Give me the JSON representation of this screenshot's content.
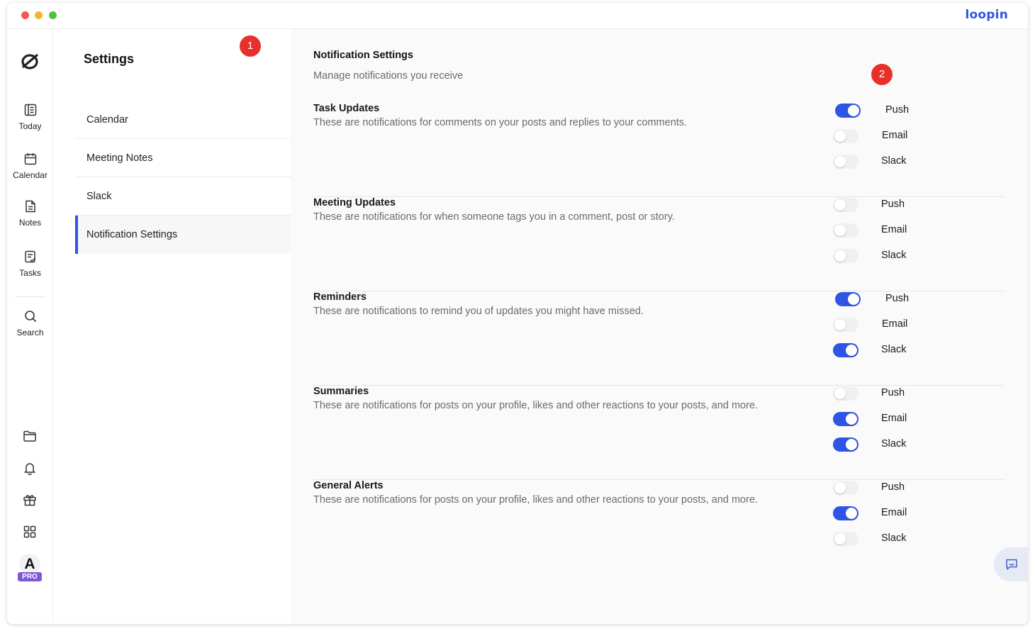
{
  "app": {
    "brand": "loopin"
  },
  "rail": {
    "items": [
      {
        "label": "Today",
        "icon": "today-icon"
      },
      {
        "label": "Calendar",
        "icon": "calendar-icon"
      },
      {
        "label": "Notes",
        "icon": "notes-icon"
      },
      {
        "label": "Tasks",
        "icon": "tasks-icon"
      },
      {
        "label": "Search",
        "icon": "search-icon"
      }
    ],
    "bottom_icons": [
      "folder-icon",
      "bell-icon",
      "gift-icon",
      "apps-grid-icon"
    ],
    "avatar": {
      "initial": "A",
      "badge": "PRO"
    }
  },
  "settings": {
    "title": "Settings",
    "step_badge": "1",
    "menu": [
      "Calendar",
      "Meeting Notes",
      "Slack",
      "Notification Settings"
    ],
    "active_item": "Notification Settings"
  },
  "notifications": {
    "title": "Notification Settings",
    "subtitle": "Manage notifications you receive",
    "step_badge": "2",
    "sections": [
      {
        "title": "Task Updates",
        "description": "These are notifications for comments on your posts and replies to your comments.",
        "toggles": [
          {
            "label": "Push",
            "on": true
          },
          {
            "label": "Email",
            "on": false
          },
          {
            "label": "Slack",
            "on": false
          }
        ]
      },
      {
        "title": "Meeting Updates",
        "description": "These are notifications for when someone tags you in a comment, post or story.",
        "toggles": [
          {
            "label": "Push",
            "on": false
          },
          {
            "label": "Email",
            "on": false
          },
          {
            "label": "Slack",
            "on": false
          }
        ]
      },
      {
        "title": "Reminders",
        "description": "These are notifications to remind you of updates you might have missed.",
        "toggles": [
          {
            "label": "Push",
            "on": true
          },
          {
            "label": "Email",
            "on": false
          },
          {
            "label": "Slack",
            "on": true
          }
        ]
      },
      {
        "title": "Summaries",
        "description": "These are notifications for posts on your profile, likes and other reactions to your posts, and more.",
        "toggles": [
          {
            "label": "Push",
            "on": false
          },
          {
            "label": "Email",
            "on": true
          },
          {
            "label": "Slack",
            "on": true
          }
        ]
      },
      {
        "title": "General Alerts",
        "description": "These are notifications for posts on your profile, likes and other reactions to your posts, and more.",
        "toggles": [
          {
            "label": "Push",
            "on": false
          },
          {
            "label": "Email",
            "on": true
          },
          {
            "label": "Slack",
            "on": false
          }
        ]
      }
    ]
  },
  "colors": {
    "accent": "#2f55e6",
    "badge": "#e8302a",
    "pro": "#7f56d9"
  }
}
